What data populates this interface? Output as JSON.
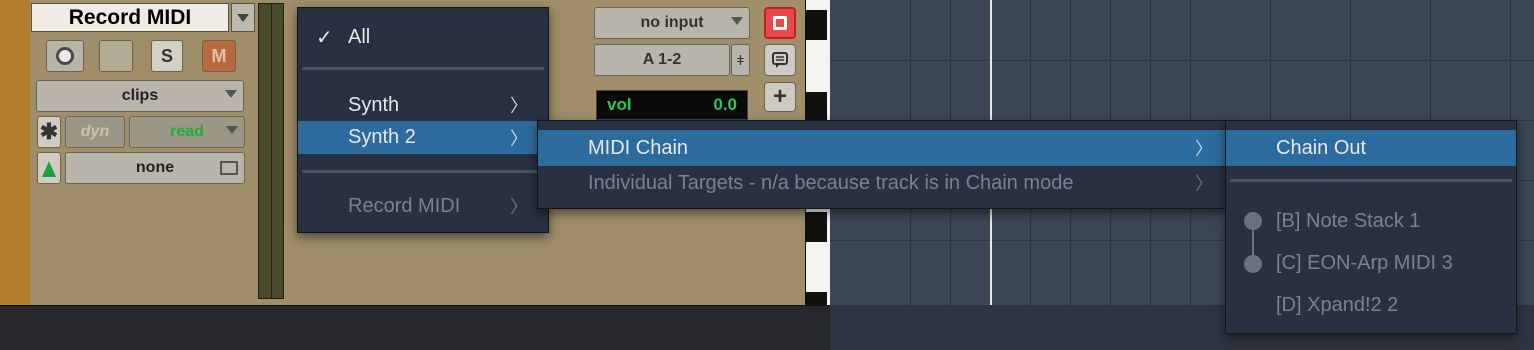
{
  "track": {
    "name": "Record MIDI",
    "solo_label": "S",
    "mute_label": "M",
    "playlist": "clips",
    "auto_dyn": "dyn",
    "auto_mode": "read",
    "group": "none",
    "input": "no input",
    "output": "A 1-2",
    "vol_label": "vol",
    "vol_value": "0.0"
  },
  "menu1": {
    "items": [
      {
        "label": "All",
        "check": "✓"
      },
      {
        "label": "Synth",
        "chev": "〉"
      },
      {
        "label": "Synth 2",
        "chev": "〉"
      },
      {
        "label": "Record MIDI",
        "chev": "〉"
      }
    ]
  },
  "menu2": {
    "items": [
      {
        "label": "MIDI Chain",
        "chev": "〉"
      },
      {
        "label": "Individual Targets - n/a because track is in Chain mode",
        "chev": "〉"
      }
    ]
  },
  "menu3": {
    "items": [
      {
        "label": "Chain Out"
      },
      {
        "label": "[B] Note Stack 1"
      },
      {
        "label": "[C] EON-Arp MIDI 3"
      },
      {
        "label": "[D] Xpand!2 2"
      }
    ]
  },
  "colors": {
    "highlight": "#2d6b9e",
    "menu_bg": "#283142",
    "track_bg": "#a08e6a",
    "read_green": "#1fae3a",
    "rec_red": "#e64a4a"
  }
}
